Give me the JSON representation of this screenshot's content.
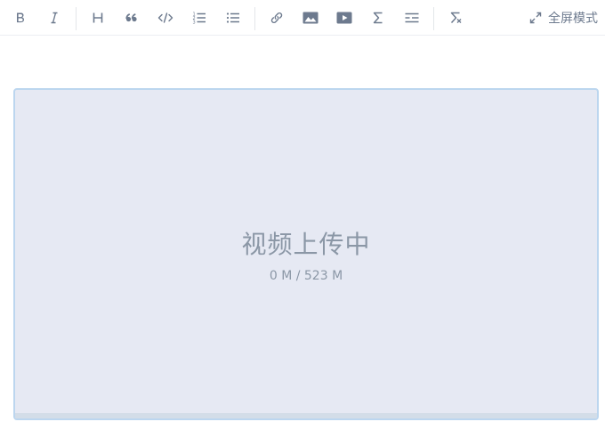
{
  "toolbar": {
    "buttons": [
      {
        "name": "bold-icon"
      },
      {
        "name": "italic-icon"
      },
      {
        "name": "heading-icon"
      },
      {
        "name": "quote-icon"
      },
      {
        "name": "code-icon"
      },
      {
        "name": "ordered-list-icon"
      },
      {
        "name": "unordered-list-icon"
      },
      {
        "name": "link-icon"
      },
      {
        "name": "image-icon"
      },
      {
        "name": "video-icon"
      },
      {
        "name": "formula-sigma-icon"
      },
      {
        "name": "horizontal-rule-icon"
      },
      {
        "name": "clear-format-icon"
      }
    ],
    "fullscreen_label": "全屏模式"
  },
  "upload": {
    "title": "视频上传中",
    "progress": "0 M / 523 M",
    "uploaded_mb": 0,
    "total_mb": 523
  },
  "colors": {
    "icon": "#6d7a8e",
    "upload_bg": "#e6e9f3",
    "upload_border": "#bcd6ef",
    "upload_text": "#8b97a6"
  }
}
